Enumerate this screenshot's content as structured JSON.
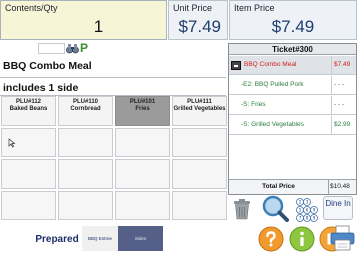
{
  "top": {
    "contents_qty_label": "Contents/Qty",
    "contents_qty_value": "1",
    "unit_price_label": "Unit Price",
    "unit_price_value": "$7.49",
    "item_price_label": "Item Price",
    "item_price_value": "$7.49"
  },
  "item": {
    "name": "BBQ Combo Meal",
    "instruction": "includes 1 side"
  },
  "grid": [
    {
      "code": "PLU#112",
      "name": "Baked Beans",
      "style": "light"
    },
    {
      "code": "PLU#110",
      "name": "Cornbread",
      "style": "light"
    },
    {
      "code": "PLU#101",
      "name": "Fries",
      "style": "dark"
    },
    {
      "code": "PLU#111",
      "name": "Grilled Vegetables",
      "style": "light"
    }
  ],
  "tabs": {
    "prepared": "Prepared",
    "bbq_entree": "BBQ Entree",
    "sides": "Sides"
  },
  "ticket": {
    "title": "Ticket#300",
    "rows": [
      {
        "desc": "BBQ Combo Meal",
        "price": "$7.49",
        "kind": "main"
      },
      {
        "desc": "-E2: BBQ Pulled Pork",
        "price": "- - -",
        "kind": "sub"
      },
      {
        "desc": "-S: Fries",
        "price": "- - -",
        "kind": "sub"
      },
      {
        "desc": "-S: Grilled Vegetables",
        "price": "$2.99",
        "kind": "sub"
      }
    ],
    "total_label": "Total Price",
    "total_value": "$10.48"
  },
  "buttons": {
    "dine_in": "Dine In"
  },
  "colors": {
    "accent_green": "#2b7e3a",
    "accent_red": "#d1221a",
    "tab_active": "#556088"
  }
}
